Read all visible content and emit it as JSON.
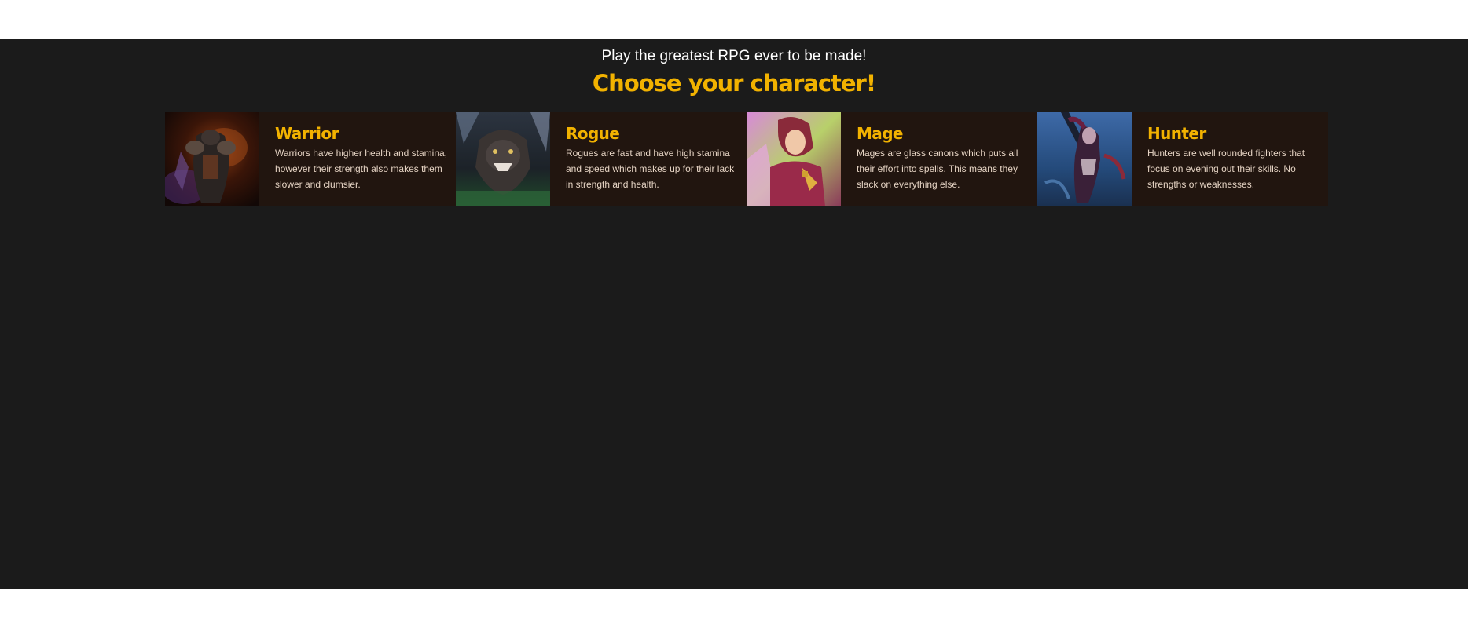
{
  "header": {
    "tagline": "Play the greatest RPG ever to be made!",
    "headline": "Choose your character!"
  },
  "colors": {
    "accent": "#f2b200",
    "background": "#1b1b1b",
    "card_background": "#21150f",
    "description_text": "#e6d4c4"
  },
  "characters": [
    {
      "name": "Warrior",
      "description": "Warriors have higher health and stamina, however their strength also makes them slower and clumsier.",
      "portrait_icon": "warrior-portrait"
    },
    {
      "name": "Rogue",
      "description": "Rogues are fast and have high stamina and speed which makes up for their lack in strength and health.",
      "portrait_icon": "rogue-portrait"
    },
    {
      "name": "Mage",
      "description": "Mages are glass canons which puts all their effort into spells. This means they slack on everything else.",
      "portrait_icon": "mage-portrait"
    },
    {
      "name": "Hunter",
      "description": "Hunters are well rounded fighters that focus on evening out their skills. No strengths or weaknesses.",
      "portrait_icon": "hunter-portrait"
    }
  ]
}
